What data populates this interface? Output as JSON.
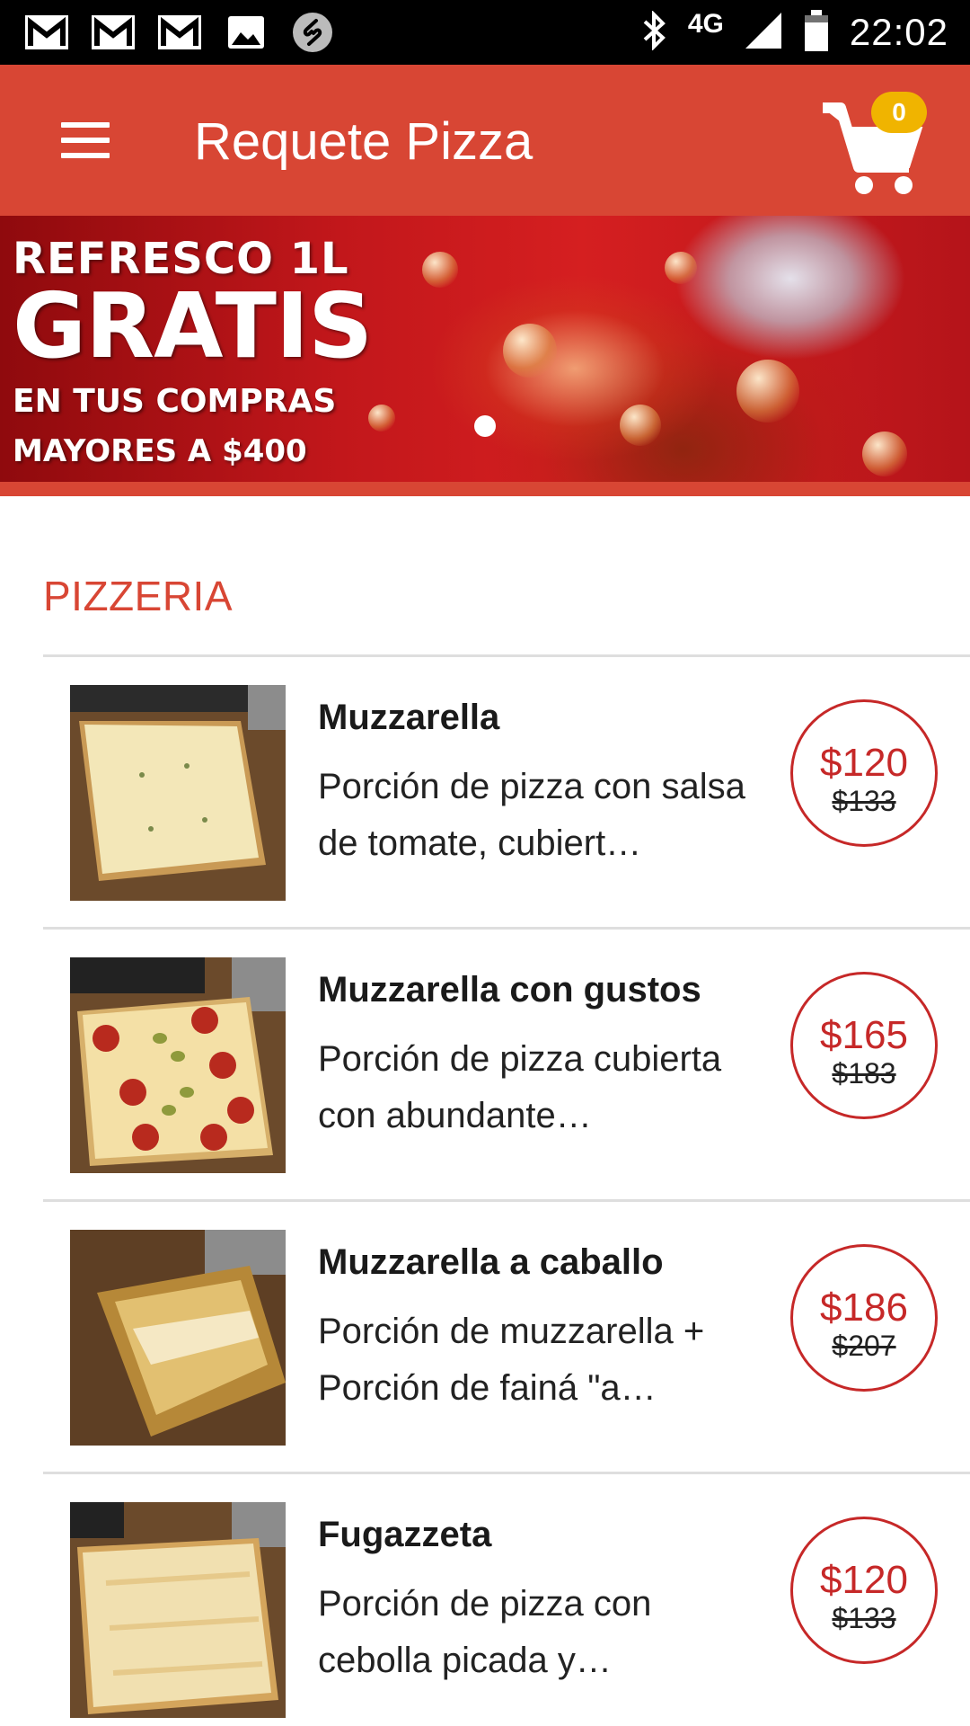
{
  "status_bar": {
    "network": "4G",
    "time": "22:02",
    "left_icons": [
      "gmail-icon",
      "gmail-icon",
      "gmail-icon",
      "image-icon",
      "shazam-icon"
    ],
    "right_icons": [
      "bluetooth-icon",
      "signal-icon",
      "battery-icon"
    ]
  },
  "app_bar": {
    "title": "Requete Pizza",
    "cart_count": "0",
    "menu_icon": "hamburger-menu-icon",
    "cart_icon": "shopping-cart-icon"
  },
  "banner": {
    "line1": "REFRESCO 1L",
    "line2": "GRATIS",
    "line3": "EN TUS COMPRAS",
    "line4": "MAYORES A $400",
    "carousel_pages": 1,
    "carousel_active": 1
  },
  "section": {
    "title": "PIZZERIA"
  },
  "items": [
    {
      "name": "Muzzarella",
      "description": "Porción de pizza con salsa de tomate, cubiert…",
      "price": "$120",
      "original_price": "$133"
    },
    {
      "name": "Muzzarella con gustos",
      "description": "Porción de pizza cubierta con abundante…",
      "price": "$165",
      "original_price": "$183"
    },
    {
      "name": "Muzzarella a caballo",
      "description": "Porción de muzzarella + Porción de fainá \"a…",
      "price": "$186",
      "original_price": "$207"
    },
    {
      "name": "Fugazzeta",
      "description": "Porción de pizza con cebolla picada y…",
      "price": "$120",
      "original_price": "$133"
    }
  ],
  "colors": {
    "brand": "#d84634",
    "price": "#c62828",
    "badge": "#f0b400",
    "status_bar": "#000000"
  }
}
